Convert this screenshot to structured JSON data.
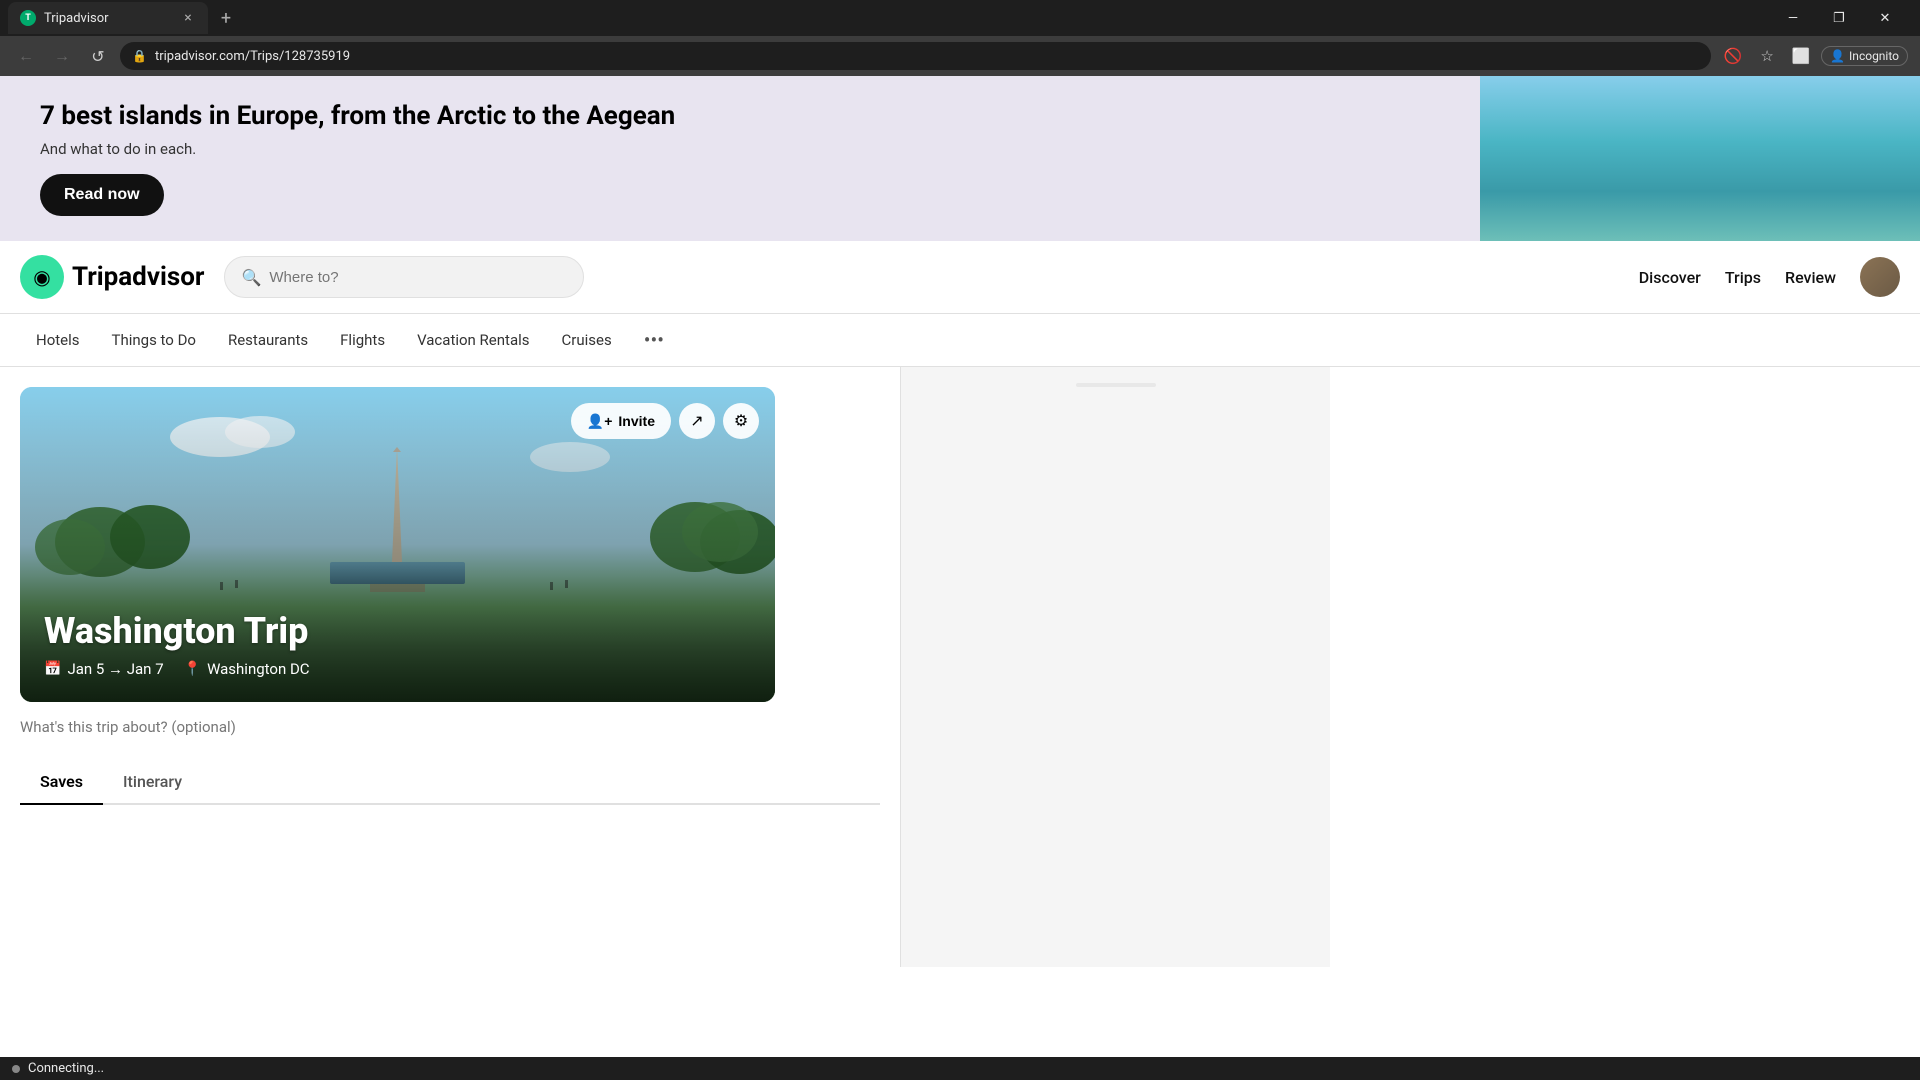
{
  "browser": {
    "tab": {
      "favicon_text": "T",
      "title": "Tripadvisor",
      "close_label": "×"
    },
    "new_tab_label": "+",
    "window_controls": {
      "minimize": "—",
      "maximize": "❐",
      "close": "✕"
    },
    "toolbar": {
      "back_icon": "←",
      "forward_icon": "→",
      "refresh_icon": "↺",
      "url": "tripadvisor.com/Trips/128735919",
      "lock_icon": "🔒",
      "bookmark_icon": "☆",
      "extensions_icon": "🧩",
      "profile_label": "Incognito",
      "profile_icon": "👤"
    }
  },
  "banner": {
    "headline": "7 best islands in Europe, from the Arctic to the Aegean",
    "subtext": "And what to do in each.",
    "cta_label": "Read now"
  },
  "header": {
    "logo_text": "Tripadvisor",
    "search_placeholder": "Where to?",
    "nav": {
      "discover": "Discover",
      "trips": "Trips",
      "review": "Review"
    }
  },
  "nav_bar": {
    "items": [
      {
        "label": "Hotels"
      },
      {
        "label": "Things to Do"
      },
      {
        "label": "Restaurants"
      },
      {
        "label": "Flights"
      },
      {
        "label": "Vacation Rentals"
      },
      {
        "label": "Cruises"
      }
    ],
    "more_icon": "•••"
  },
  "trip": {
    "title": "Washington Trip",
    "date": "Jan 5 → Jan 7",
    "location": "Washington DC",
    "description": "What's this trip about? (optional)",
    "invite_label": "Invite",
    "share_icon": "↗",
    "settings_icon": "⚙",
    "calendar_icon": "📅",
    "pin_icon": "📍",
    "tabs": [
      {
        "label": "Saves",
        "active": true
      },
      {
        "label": "Itinerary",
        "active": false
      }
    ]
  },
  "status_bar": {
    "text": "Connecting..."
  }
}
